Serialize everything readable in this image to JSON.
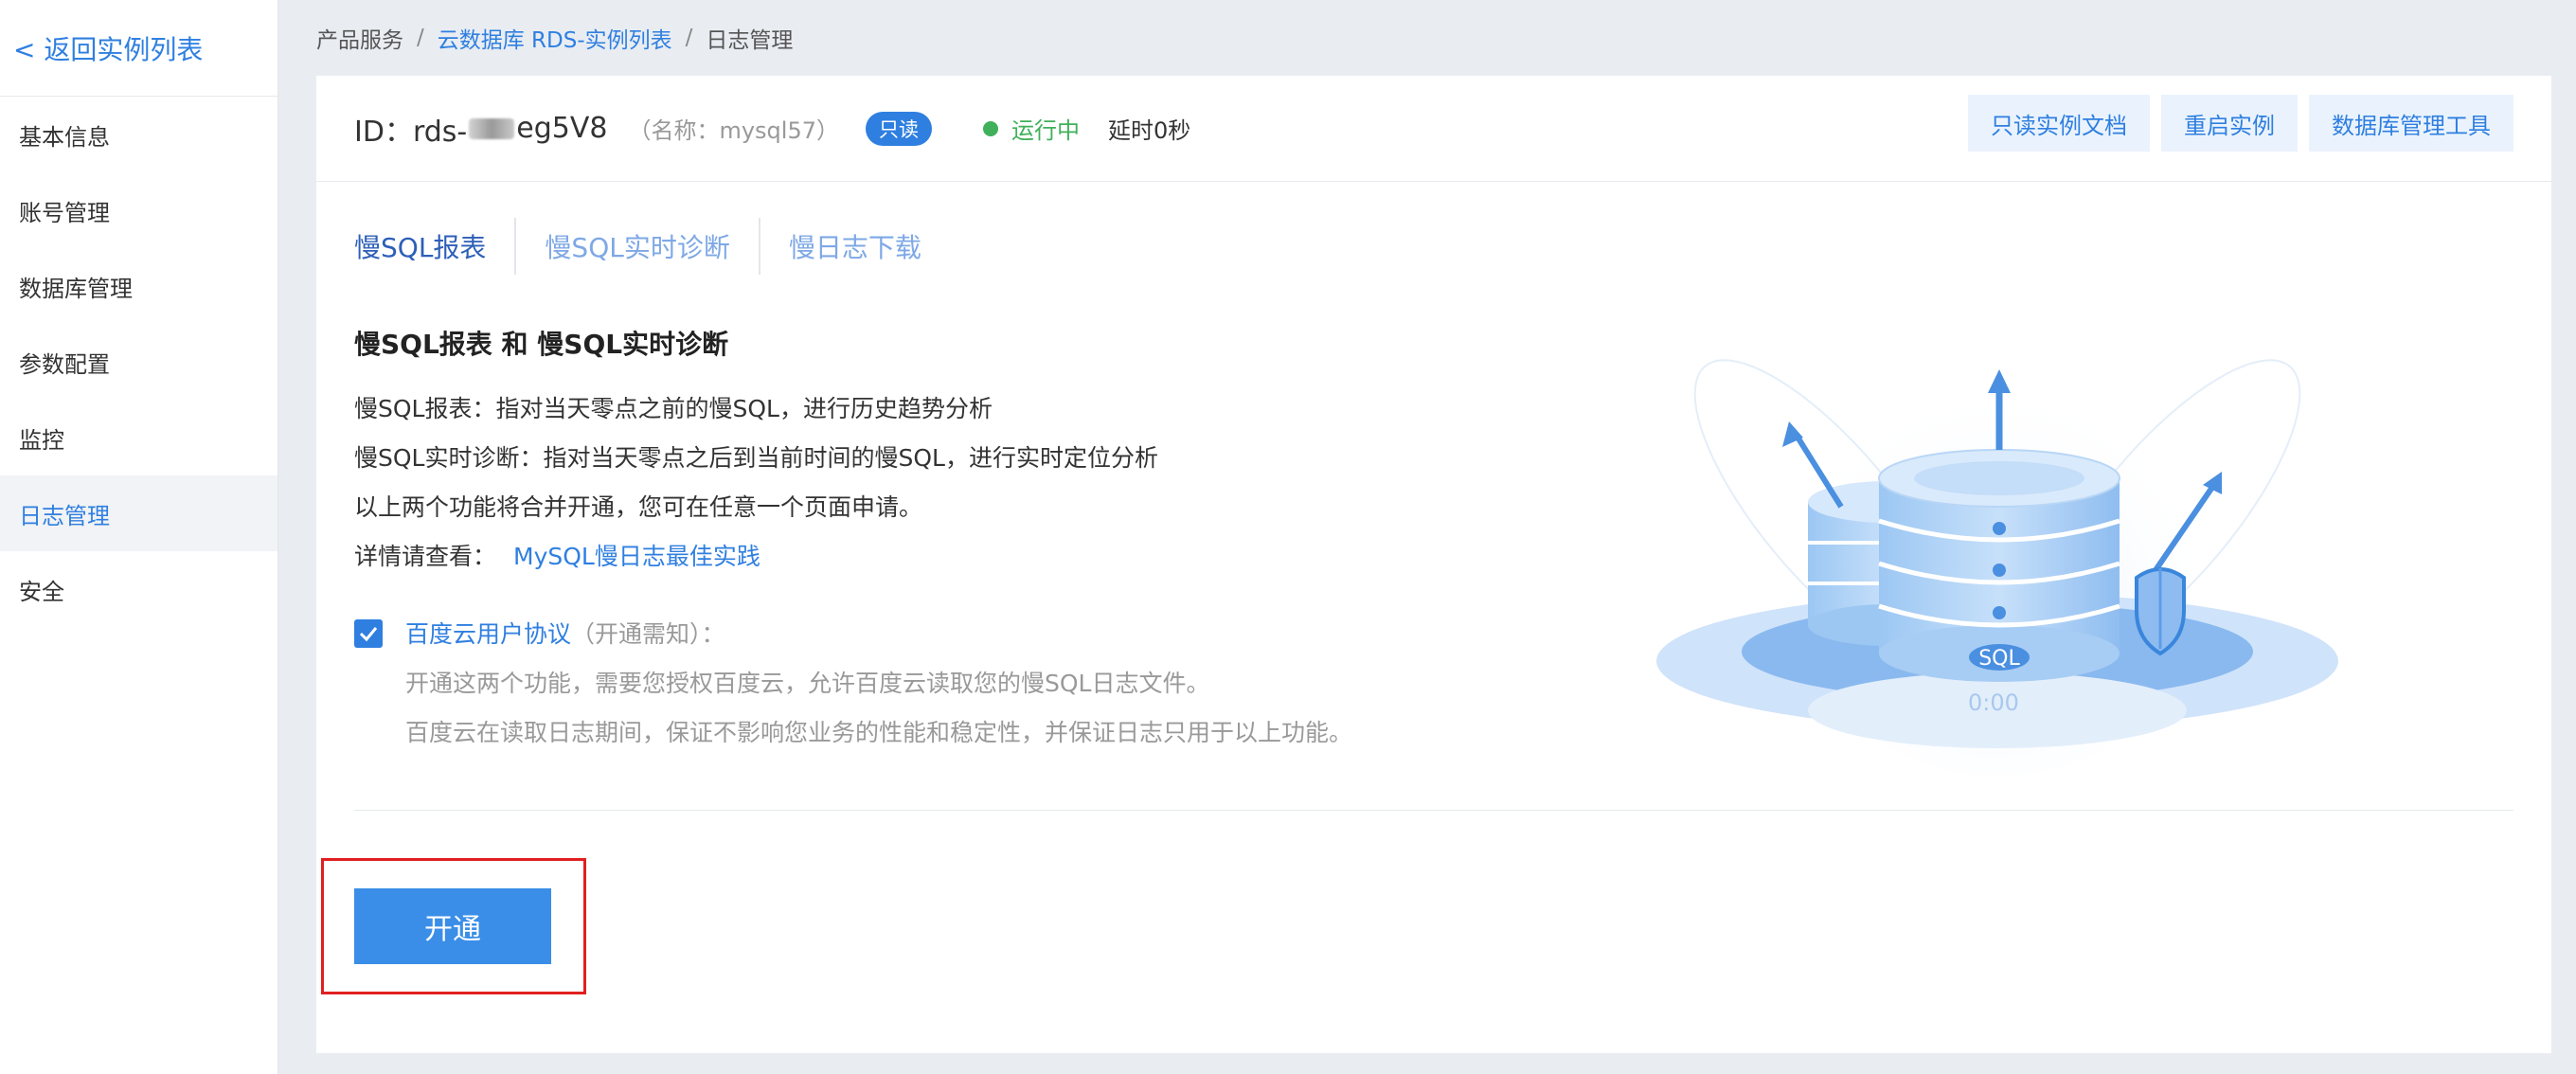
{
  "sidebar": {
    "back_label": "< 返回实例列表",
    "items": [
      {
        "label": "基本信息"
      },
      {
        "label": "账号管理"
      },
      {
        "label": "数据库管理"
      },
      {
        "label": "参数配置"
      },
      {
        "label": "监控"
      },
      {
        "label": "日志管理",
        "active": true
      },
      {
        "label": "安全"
      }
    ]
  },
  "breadcrumb": {
    "item1": "产品服务",
    "item2": "云数据库 RDS-实例列表",
    "item3": "日志管理",
    "separator": "/"
  },
  "instance": {
    "id_prefix": "ID：rds-",
    "id_suffix": "eg5V8",
    "name": "（名称：mysql57）",
    "badge": "只读",
    "status": "运行中",
    "delay": "延时0秒",
    "status_color": "#40b05a"
  },
  "header_actions": {
    "docs": "只读实例文档",
    "restart": "重启实例",
    "db_tool": "数据库管理工具"
  },
  "tabs": [
    {
      "label": "慢SQL报表",
      "active": true
    },
    {
      "label": "慢SQL实时诊断"
    },
    {
      "label": "慢日志下载"
    }
  ],
  "content": {
    "title": "慢SQL报表 和 慢SQL实时诊断",
    "line1": "慢SQL报表：指对当天零点之前的慢SQL，进行历史趋势分析",
    "line2": "慢SQL实时诊断：指对当天零点之后到当前时间的慢SQL，进行实时定位分析",
    "line3": "以上两个功能将合并开通，您可在任意一个页面申请。",
    "line4_label": "详情请查看：",
    "line4_link": "MySQL慢日志最佳实践"
  },
  "agreement": {
    "checked": true,
    "link": "百度云用户协议",
    "note": "（开通需知）：",
    "detail1": "开通这两个功能，需要您授权百度云，允许百度云读取您的慢SQL日志文件。",
    "detail2": "百度云在读取日志期间，保证不影响您业务的性能和稳定性，并保证日志只用于以上功能。"
  },
  "open_button": "开通",
  "illustration": {
    "sql_label": "SQL",
    "time": "0:00"
  },
  "colors": {
    "accent": "#2f7fe0",
    "highlight": "#e02020",
    "button": "#3a8ee8"
  }
}
